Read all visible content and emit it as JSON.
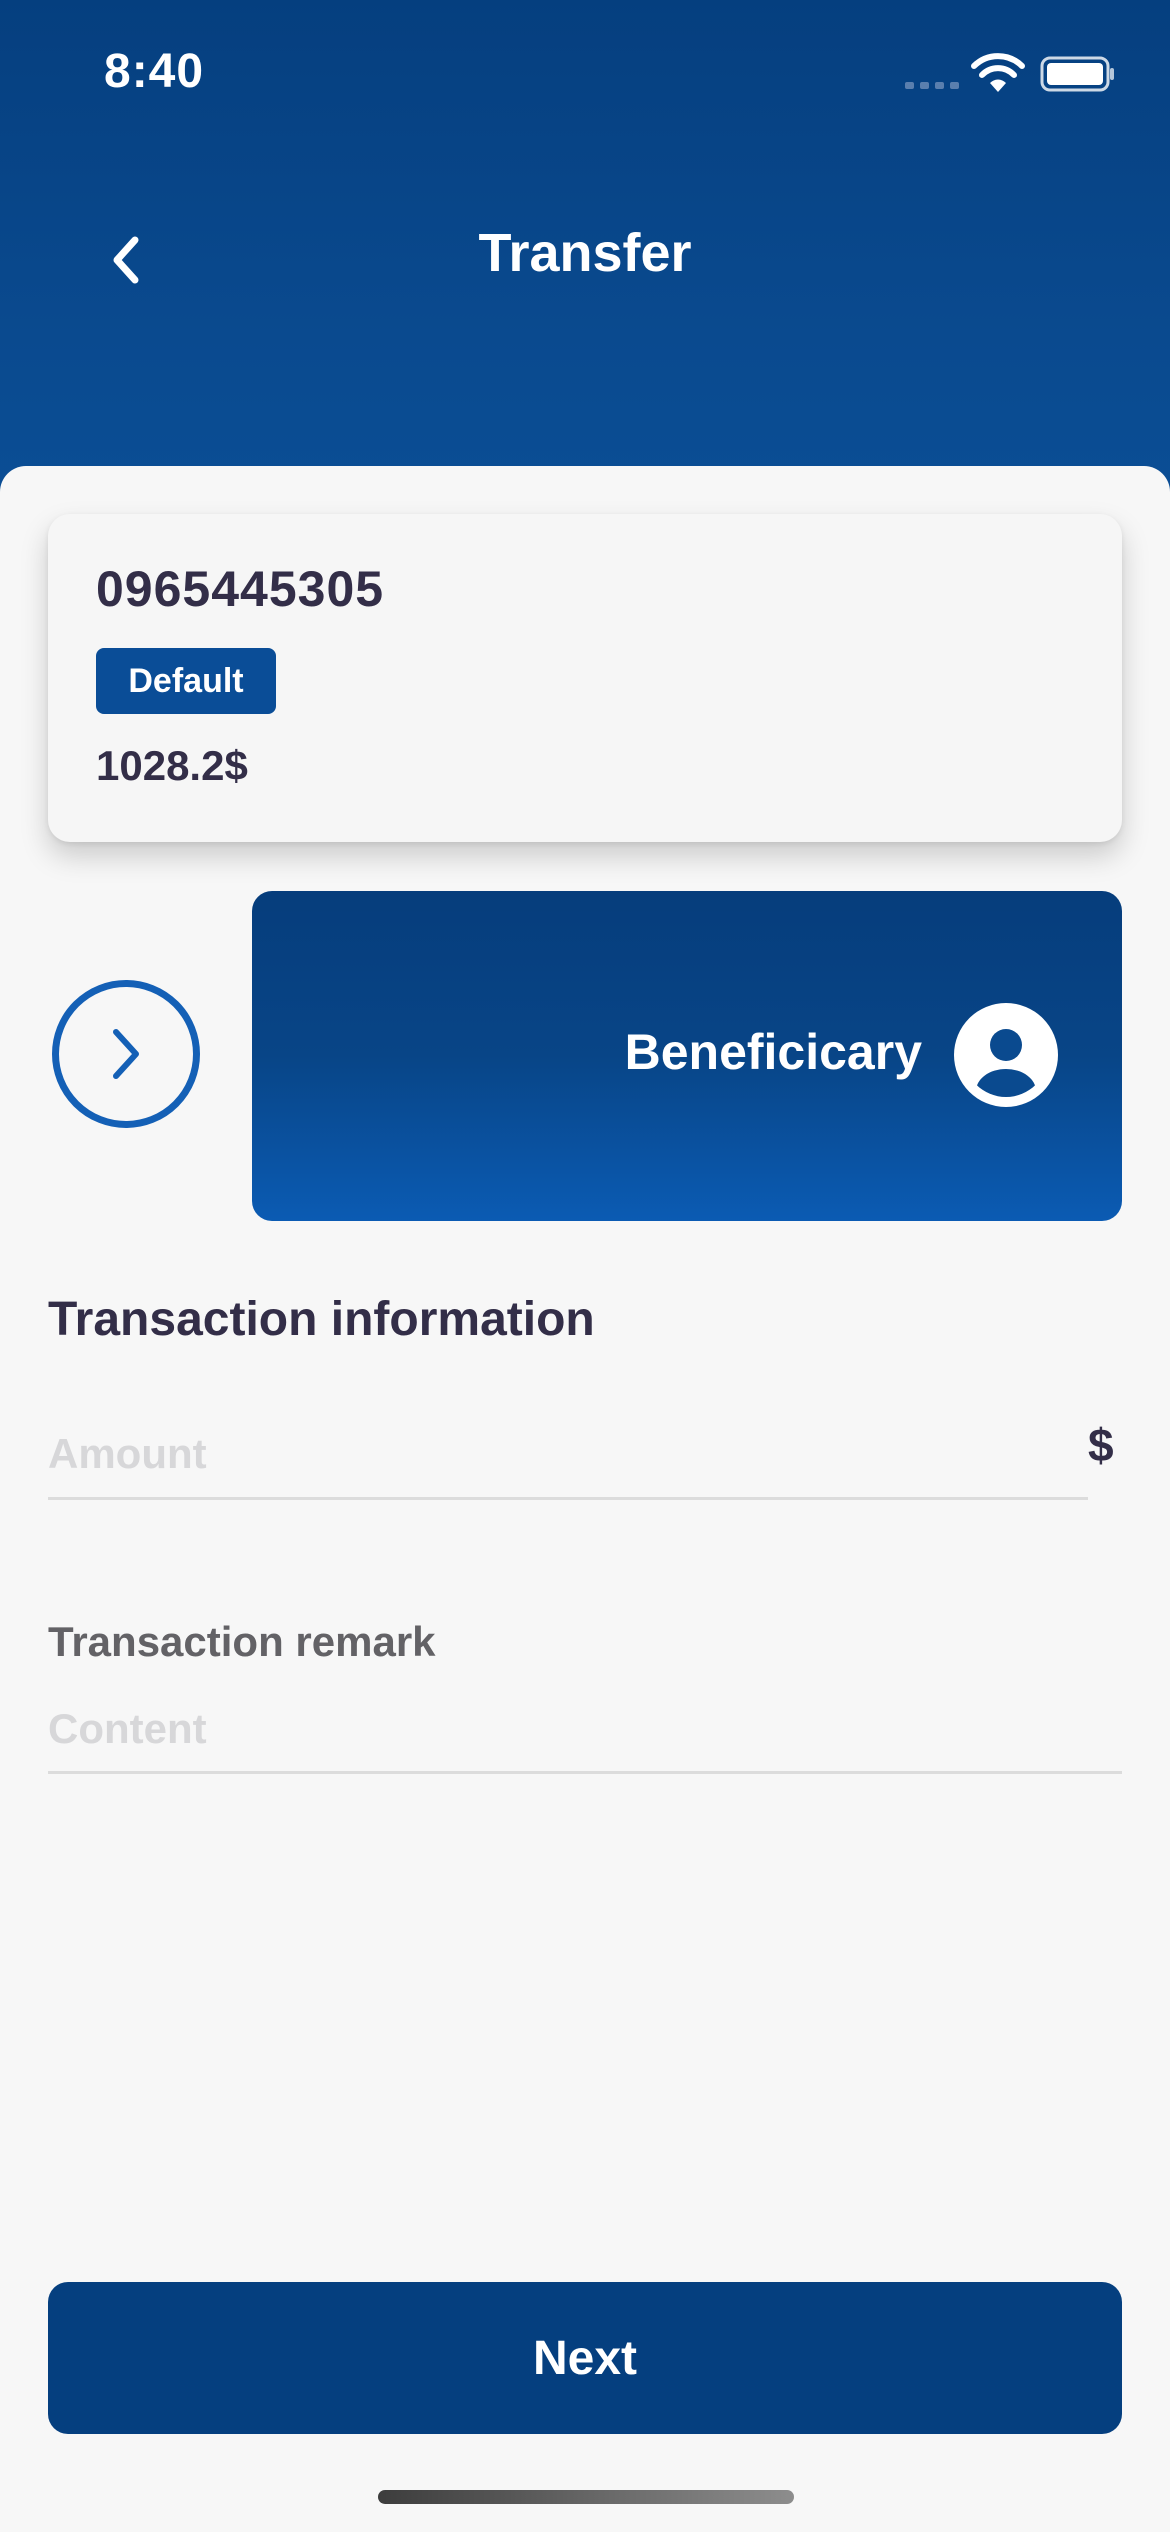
{
  "status_bar": {
    "time": "8:40"
  },
  "header": {
    "title": "Transfer"
  },
  "account": {
    "number": "0965445305",
    "badge": "Default",
    "balance": "1028.2$"
  },
  "beneficiary": {
    "label": "Beneficicary"
  },
  "transaction": {
    "section_title": "Transaction information",
    "amount_placeholder": "Amount",
    "currency": "$",
    "remark_label": "Transaction remark",
    "remark_placeholder": "Content"
  },
  "footer": {
    "next_label": "Next"
  },
  "colors": {
    "primary": "#053f7f",
    "accent": "#1460b6",
    "text": "#332e48",
    "placeholder": "#d7d7d9"
  }
}
